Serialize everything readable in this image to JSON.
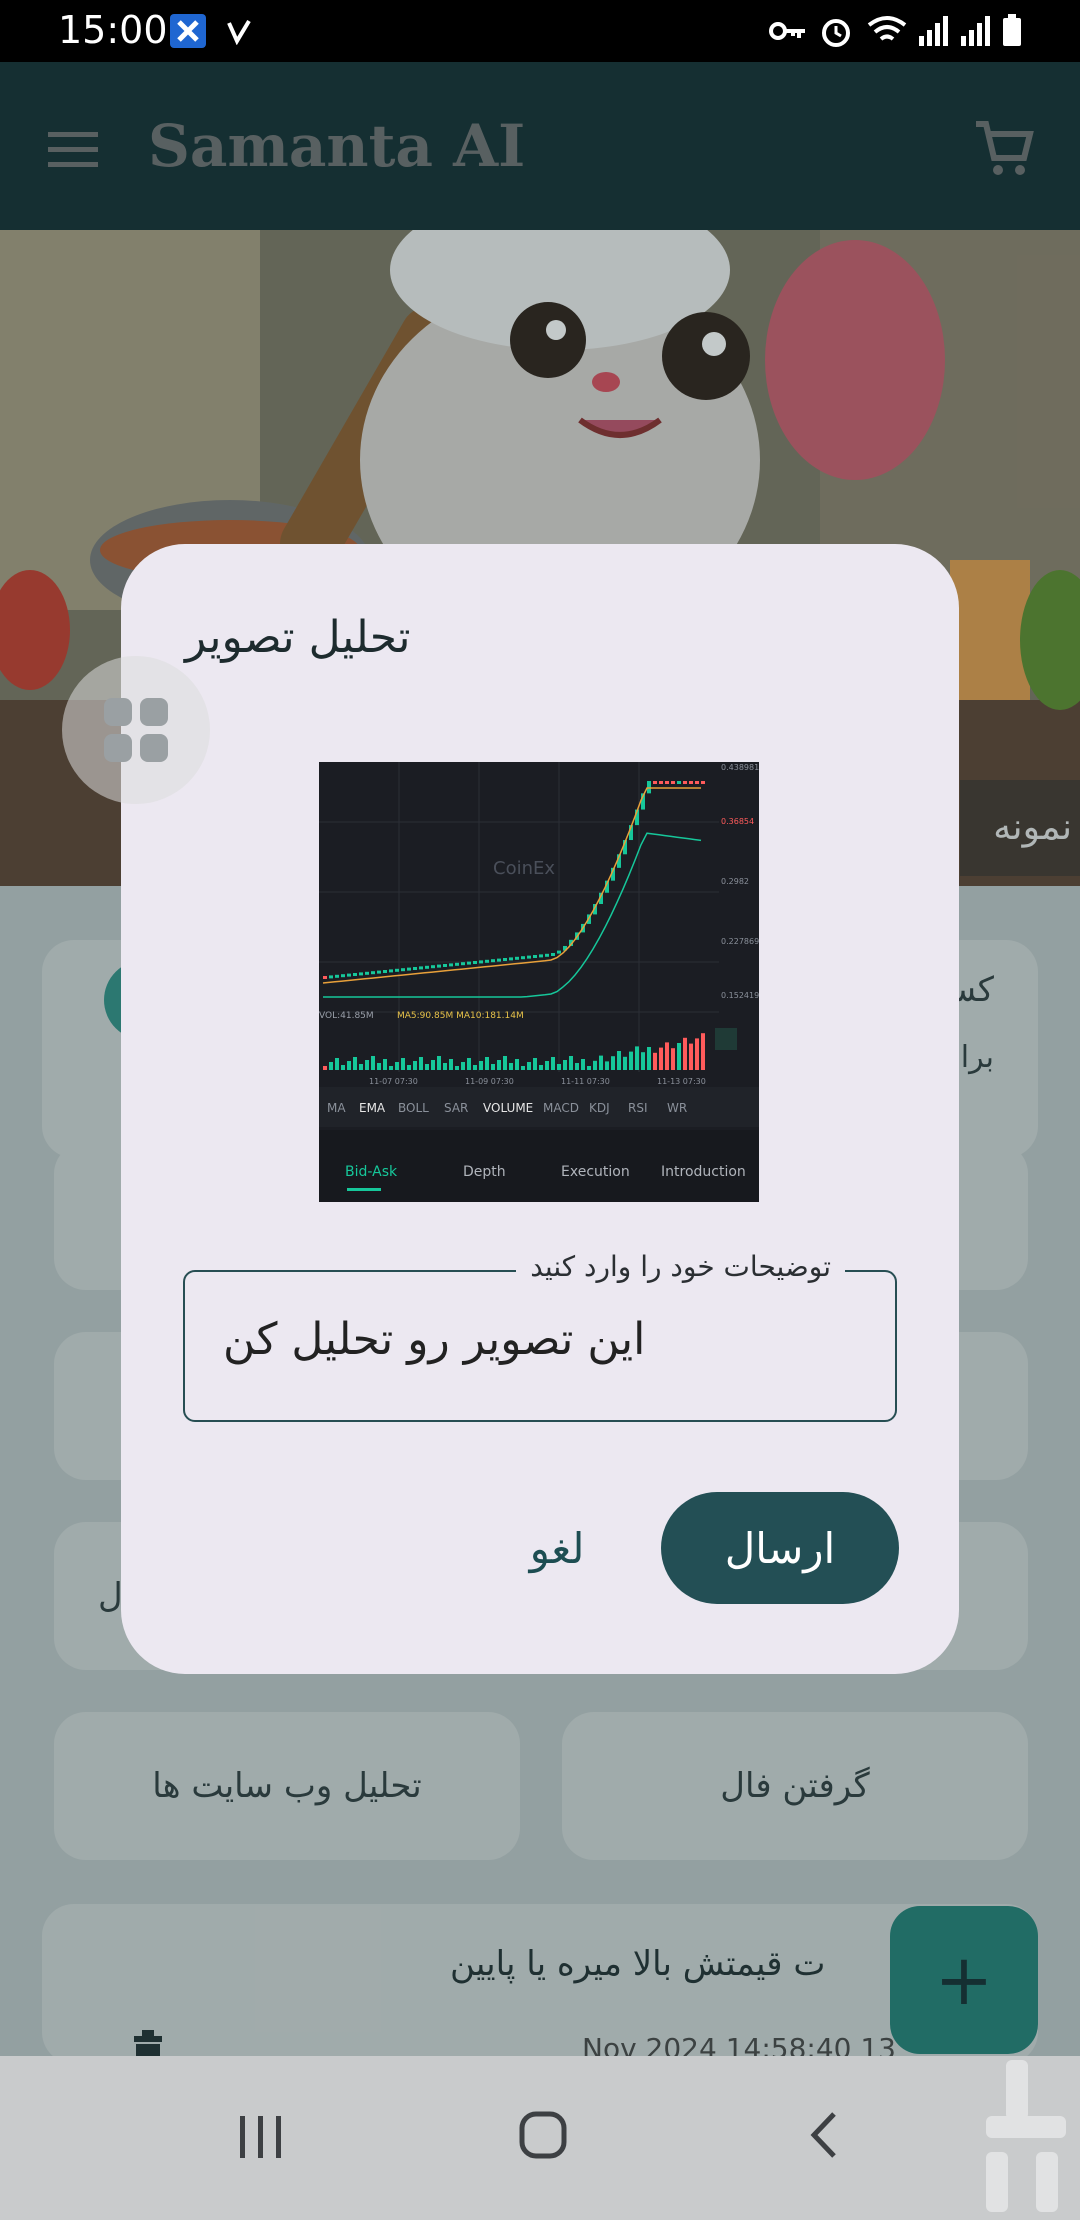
{
  "status_bar": {
    "time": "15:00",
    "icons": [
      "x-app-icon",
      "v-app-icon",
      "key-icon",
      "alarm-icon",
      "wifi-icon",
      "signal-icon",
      "signal-icon",
      "battery-icon"
    ]
  },
  "app_bar": {
    "title": "Samanta AI",
    "menu_icon": "menu-icon",
    "cart_icon": "cart-icon"
  },
  "hero": {
    "caption": "نمونه"
  },
  "background": {
    "card_text_1": "کس",
    "card_text_2": "برا",
    "chip_partial": "ل",
    "chip_web_analysis": "تحلیل وب سایت ها",
    "chip_fortune": "گرفتن فال",
    "history_text": "ت قیمتش بالا میره یا پایین",
    "history_date": "Nov 2024 14:58:40 13"
  },
  "dialog": {
    "title": "تحلیل تصویر",
    "input_label": "توضیحات خود را وارد کنید",
    "input_value": "این تصویر رو تحلیل کن",
    "cancel_label": "لغو",
    "send_label": "ارسال"
  },
  "preview_image": {
    "watermark": "CoinEx",
    "indicators": "MA5:90.85M    MA10:181.14M",
    "vol_label": "VOL:41.85M",
    "tabs_row1": [
      "MA",
      "EMA",
      "BOLL",
      "SAR",
      "VOLUME",
      "MACD",
      "KDJ",
      "RSI",
      "WR"
    ],
    "tabs_row2": [
      "Bid-Ask",
      "Depth",
      "Execution",
      "Introduction"
    ],
    "axis_dates": [
      "11-07 07:30",
      "11-09 07:30",
      "11-11 07:30",
      "11-13 07:30"
    ],
    "price_labels": [
      "0.438981",
      "0.36854",
      "0.2982",
      "0.227869",
      "0.152419"
    ],
    "accent_colors": {
      "up": "#16c79a",
      "down": "#ff5b5b",
      "ma_orange": "#e8a03a"
    }
  },
  "fab": {
    "icon": "plus-icon",
    "label": "+"
  },
  "nav_bar": {
    "icons": [
      "recent-apps-icon",
      "home-icon",
      "back-icon"
    ]
  }
}
